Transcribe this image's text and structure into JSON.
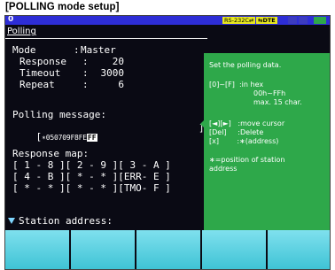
{
  "header": {
    "title": "[POLLING mode setup]"
  },
  "status": {
    "channel_number": "0",
    "rs_badge": "RS-232C⇄",
    "dte_badge": "⇆DTE",
    "colors": {
      "bar": "#2d2dd6",
      "badge": "#e8e820",
      "accent_green": "#2ea84a"
    }
  },
  "tab": {
    "label": "Polling"
  },
  "settings": {
    "mode": {
      "label": "Mode",
      "value": "Master"
    },
    "response": {
      "label": "Response",
      "value": "20"
    },
    "timeout": {
      "label": "Timeout",
      "value": "3000"
    },
    "repeat": {
      "label": "Repeat",
      "value": "6"
    }
  },
  "polling_message": {
    "label": "Polling message:",
    "open_bracket": "[",
    "value": "∗050709F8FE",
    "cursor_char": "FF",
    "close_bracket": "]"
  },
  "response_map": {
    "label": "Response map:",
    "rows": [
      "[ 1 - 8 ][ 2 - 9 ][ 3 - A ]",
      "[ 4 - B ][ * - * ][ERR- E ]",
      "[ * - * ][ * - * ][TMO- F ]"
    ]
  },
  "help": {
    "title": "Set the polling data.",
    "line_keys": "[0]~[F]  :in hex",
    "line_range": "00h~FFh",
    "line_max": "max. 15 char.",
    "line_move": "[◄][►]   :move cursor",
    "line_del": "[Del]     :Delete",
    "line_x": "[x]        :∗(address)",
    "line_note1": "∗=position of station",
    "line_note2": "address"
  },
  "station": {
    "label": "Station address:"
  },
  "function_keys": [
    "",
    "",
    "",
    "",
    ""
  ]
}
